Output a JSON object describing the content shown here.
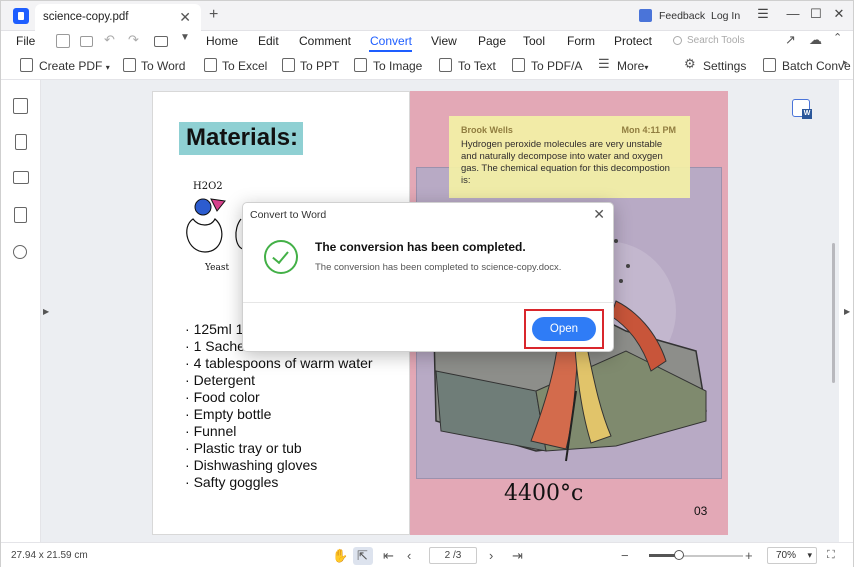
{
  "titlebar": {
    "tab_title": "science-copy.pdf",
    "close": "✕",
    "add": "+",
    "feedback": "Feedback",
    "login": "Log In",
    "minimize": "—",
    "maximize": "☐",
    "close_window": "✕"
  },
  "menubar": {
    "file": "File",
    "items": [
      "Home",
      "Edit",
      "Comment",
      "Convert",
      "View",
      "Page",
      "Tool",
      "Form",
      "Protect"
    ],
    "active": "Convert",
    "search_placeholder": "Search Tools"
  },
  "toolbar": {
    "create_pdf": "Create PDF",
    "to_word": "To Word",
    "to_excel": "To Excel",
    "to_ppt": "To PPT",
    "to_image": "To Image",
    "to_text": "To Text",
    "to_pdfa": "To PDF/A",
    "more": "More",
    "settings": "Settings",
    "batch_convert": "Batch Conve"
  },
  "page_left": {
    "heading": "Materials:",
    "items": [
      "125ml 1",
      "1 Sachet",
      "4 tablespoons of warm water",
      "Detergent",
      "Food color",
      "Empty bottle",
      "Funnel",
      "Plastic tray or tub",
      "Dishwashing gloves",
      "Safty goggles"
    ],
    "sketch_label_1": "H2O2",
    "sketch_label_2": "Yeast"
  },
  "page_right": {
    "annotation_author": "Brook Wells",
    "annotation_time": "Mon 4:11 PM",
    "annotation_text": "Hydrogen peroxide molecules are very unstable and naturally decompose into water and oxygen gas. The chemical equation for this decompostion is:",
    "temperature": "4400°c",
    "page_number": "03"
  },
  "dialog": {
    "title": "Convert to Word",
    "heading": "The conversion has been completed.",
    "message": "The conversion has been completed to science-copy.docx.",
    "open_button": "Open"
  },
  "statusbar": {
    "dimensions": "27.94 x 21.59 cm",
    "page": "2 /3",
    "zoom": "70%",
    "zoom_level": 0.32
  },
  "colors": {
    "accent": "#1e5eff",
    "open_button": "#2f7cf6",
    "highlight_border": "#d9262c",
    "success": "#43b047",
    "right_page": "#e3a8b6",
    "heading_bg": "#8fd0d3",
    "annotation_bg": "#f4f1a6"
  }
}
